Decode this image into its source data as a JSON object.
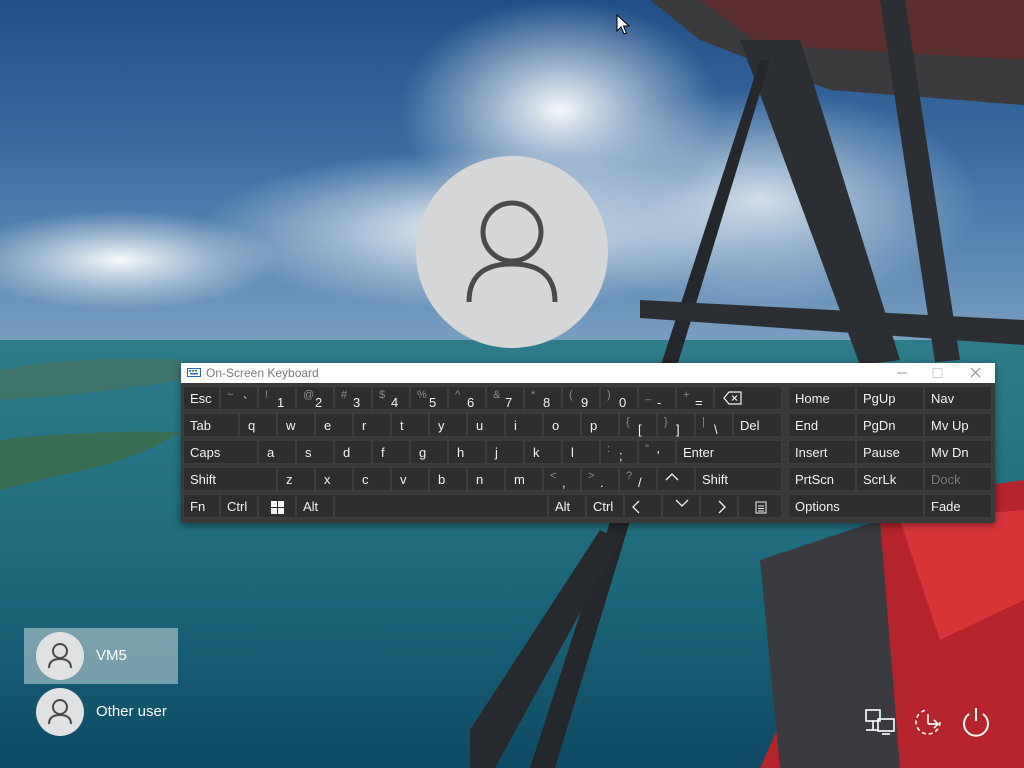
{
  "osk": {
    "title": "On-Screen Keyboard",
    "rows": [
      [
        {
          "main": "Esc"
        },
        {
          "sym": "~",
          "alt": "`"
        },
        {
          "sym": "!",
          "alt": "1"
        },
        {
          "sym": "@",
          "alt": "2"
        },
        {
          "sym": "#",
          "alt": "3"
        },
        {
          "sym": "$",
          "alt": "4"
        },
        {
          "sym": "%",
          "alt": "5"
        },
        {
          "sym": "^",
          "alt": "6"
        },
        {
          "sym": "&",
          "alt": "7"
        },
        {
          "sym": "*",
          "alt": "8"
        },
        {
          "sym": "(",
          "alt": "9"
        },
        {
          "sym": ")",
          "alt": "0"
        },
        {
          "sym": "_",
          "alt": "-"
        },
        {
          "sym": "+",
          "alt": "="
        },
        {
          "icon": "backspace-icon"
        }
      ],
      [
        {
          "main": "Tab"
        },
        {
          "main": "q"
        },
        {
          "main": "w"
        },
        {
          "main": "e"
        },
        {
          "main": "r"
        },
        {
          "main": "t"
        },
        {
          "main": "y"
        },
        {
          "main": "u"
        },
        {
          "main": "i"
        },
        {
          "main": "o"
        },
        {
          "main": "p"
        },
        {
          "sym": "{",
          "alt": "["
        },
        {
          "sym": "}",
          "alt": "]"
        },
        {
          "sym": "|",
          "alt": "\\"
        },
        {
          "main": "Del"
        }
      ],
      [
        {
          "main": "Caps"
        },
        {
          "main": "a"
        },
        {
          "main": "s"
        },
        {
          "main": "d"
        },
        {
          "main": "f"
        },
        {
          "main": "g"
        },
        {
          "main": "h"
        },
        {
          "main": "j"
        },
        {
          "main": "k"
        },
        {
          "main": "l"
        },
        {
          "sym": ":",
          "alt": ";"
        },
        {
          "sym": "\"",
          "alt": "'"
        },
        {
          "main": "Enter"
        }
      ],
      [
        {
          "main": "Shift"
        },
        {
          "main": "z"
        },
        {
          "main": "x"
        },
        {
          "main": "c"
        },
        {
          "main": "v"
        },
        {
          "main": "b"
        },
        {
          "main": "n"
        },
        {
          "main": "m"
        },
        {
          "sym": "<",
          "alt": ","
        },
        {
          "sym": ">",
          "alt": "."
        },
        {
          "sym": "?",
          "alt": "/"
        },
        {
          "icon": "arrow-up-icon"
        },
        {
          "main": "Shift"
        }
      ],
      [
        {
          "main": "Fn"
        },
        {
          "main": "Ctrl"
        },
        {
          "icon": "windows-icon"
        },
        {
          "main": "Alt"
        },
        {
          "main": ""
        },
        {
          "main": "Alt"
        },
        {
          "main": "Ctrl"
        },
        {
          "icon": "arrow-left-icon"
        },
        {
          "icon": "arrow-down-icon"
        },
        {
          "icon": "arrow-right-icon"
        },
        {
          "icon": "menu-key-icon"
        }
      ]
    ],
    "nav_keys": [
      [
        "Home",
        "PgUp",
        "Nav"
      ],
      [
        "End",
        "PgDn",
        "Mv Up"
      ],
      [
        "Insert",
        "Pause",
        "Mv Dn"
      ],
      [
        "PrtScn",
        "ScrLk",
        "Dock"
      ],
      [
        "Options",
        "Fade"
      ]
    ]
  },
  "users": [
    {
      "name": "VM5",
      "selected": true
    },
    {
      "name": "Other user",
      "selected": false
    }
  ],
  "system_icons": [
    "network-icon",
    "ease-of-access-icon",
    "power-icon"
  ]
}
